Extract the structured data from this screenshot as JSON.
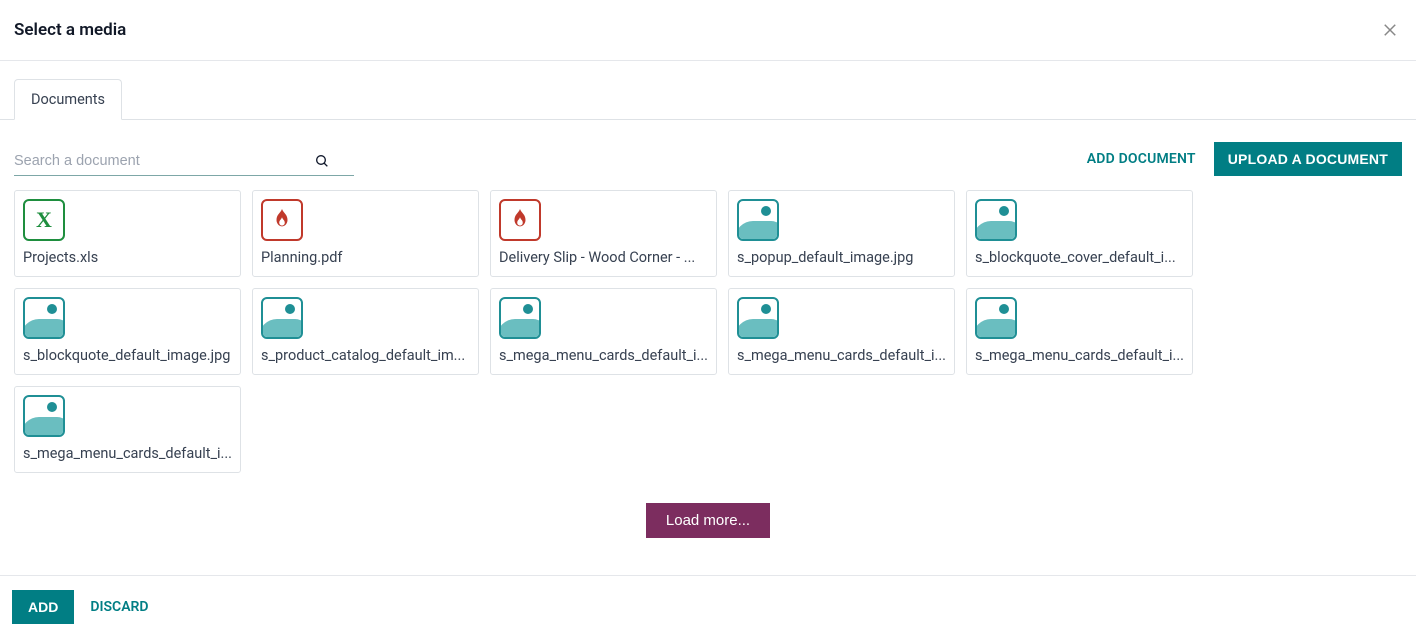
{
  "header": {
    "title": "Select a media"
  },
  "tabs": {
    "documents": "Documents"
  },
  "search": {
    "placeholder": "Search a document"
  },
  "toolbar": {
    "add_document": "ADD DOCUMENT",
    "upload_document": "UPLOAD A DOCUMENT"
  },
  "documents": [
    {
      "name": "Projects.xls",
      "type": "xls"
    },
    {
      "name": "Planning.pdf",
      "type": "pdf"
    },
    {
      "name": "Delivery Slip - Wood Corner - ...",
      "type": "pdf"
    },
    {
      "name": "s_popup_default_image.jpg",
      "type": "img"
    },
    {
      "name": "s_blockquote_cover_default_i...",
      "type": "img"
    },
    {
      "name": "s_blockquote_default_image.jpg",
      "type": "img"
    },
    {
      "name": "s_product_catalog_default_im...",
      "type": "img"
    },
    {
      "name": "s_mega_menu_cards_default_i...",
      "type": "img"
    },
    {
      "name": "s_mega_menu_cards_default_i...",
      "type": "img"
    },
    {
      "name": "s_mega_menu_cards_default_i...",
      "type": "img"
    },
    {
      "name": "s_mega_menu_cards_default_i...",
      "type": "img"
    }
  ],
  "load_more": "Load more...",
  "footer": {
    "add": "ADD",
    "discard": "DISCARD"
  }
}
